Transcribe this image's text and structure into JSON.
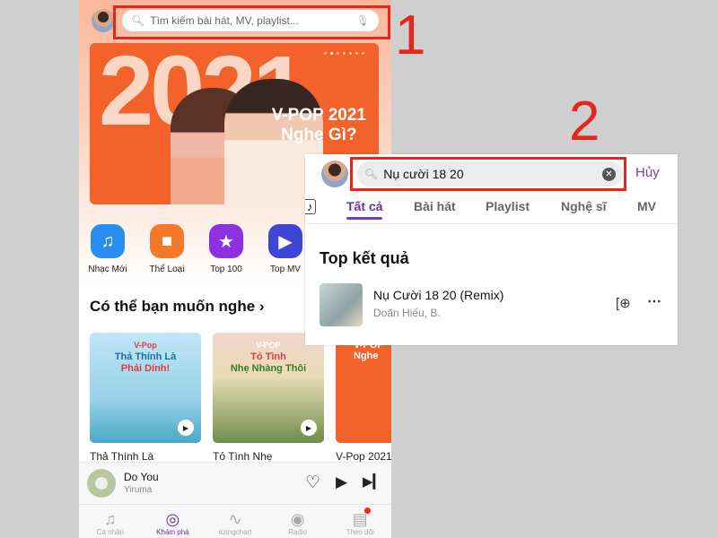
{
  "annotations": {
    "step1": "1",
    "step2": "2"
  },
  "home": {
    "search_placeholder": "Tìm kiếm bài hát, MV, playlist...",
    "banner": {
      "big_text": "2021",
      "line1": "V-POP 2021",
      "line2": "Nghe Gì?"
    },
    "categories": [
      {
        "label": "Nhạc Mới",
        "icon": "music-note-icon",
        "color": "#2a8ef0"
      },
      {
        "label": "Thể Loại",
        "icon": "shapes-icon",
        "color": "#f47a2a"
      },
      {
        "label": "Top 100",
        "icon": "star-icon",
        "color": "#8e2fe0"
      },
      {
        "label": "Top MV",
        "icon": "video-icon",
        "color": "#3f45d6"
      }
    ],
    "section_title": "Có thể bạn muốn nghe",
    "cards": [
      {
        "tag": "V-Pop",
        "line1": "Thả Thính Là",
        "line2": "Phải Dính!",
        "title": "Thả Thính Là"
      },
      {
        "tag": "V-POP",
        "line1": "Tỏ Tình",
        "line2": "Nhẹ Nhàng Thôi",
        "title": "Tỏ Tình Nhẹ"
      },
      {
        "tag": "V-POP",
        "line1": "Nghe",
        "line2": "",
        "title": "V-Pop 2021"
      }
    ],
    "player": {
      "song": "Do You",
      "artist": "Yiruma"
    },
    "nav": [
      {
        "label": "Cá nhân",
        "icon": "library-icon"
      },
      {
        "label": "Khám phá",
        "icon": "disc-icon"
      },
      {
        "label": "#zingchart",
        "icon": "chart-icon"
      },
      {
        "label": "Radio",
        "icon": "radio-icon"
      },
      {
        "label": "Theo dõi",
        "icon": "feed-icon"
      }
    ]
  },
  "search": {
    "query": "Nụ cười 18 20",
    "cancel": "Hủy",
    "tabs": [
      "Tất cả",
      "Bài hát",
      "Playlist",
      "Nghệ sĩ",
      "MV"
    ],
    "active_tab": "Tất cả",
    "section": "Top kết quả",
    "result": {
      "title": "Nụ Cười 18 20 (Remix)",
      "artist": "Doãn Hiếu, B."
    }
  },
  "colors": {
    "accent": "#6b2ea3",
    "highlight": "#e4261c"
  }
}
